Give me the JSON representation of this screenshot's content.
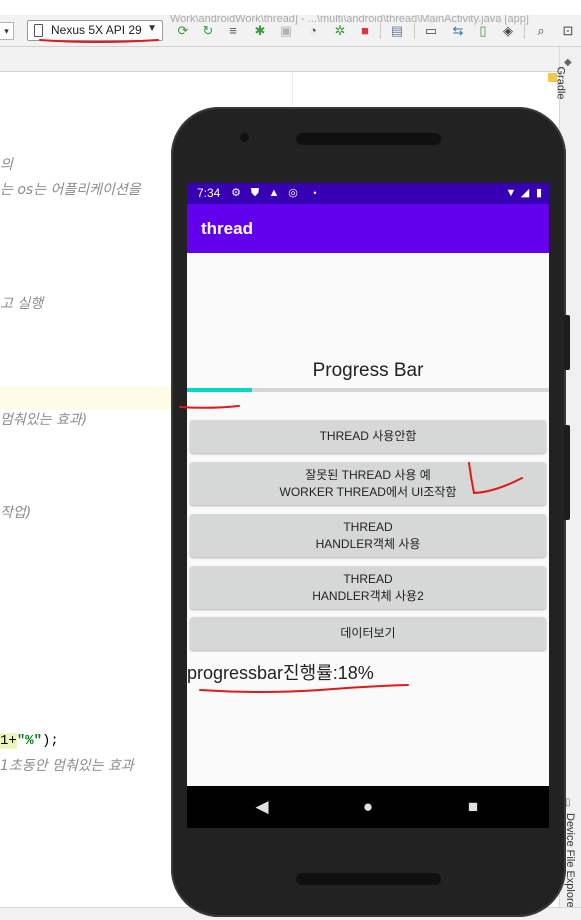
{
  "ide": {
    "title": "Work\\androidWork\\thread] - ...\\multi\\android\\thread\\MainActivity.java [app]",
    "device_select": "Nexus 5X API 29",
    "sidebar_tab_top": "Gradle",
    "sidebar_tab_bottom": "Device File Explorer",
    "code_lines": [
      "의",
      "는 os는 어플리케이션을",
      "고 실행",
      "멈춰있는 효과)",
      "작업)",
      "1초동안 멈춰있는 효과"
    ],
    "code_string_part1": "1+",
    "code_string_part2": "\"%\"",
    "code_string_part3": ");"
  },
  "device": {
    "status_time": "7:34",
    "app_title": "thread",
    "progress_label": "Progress Bar",
    "progress": 0.18,
    "buttons": [
      {
        "line1": "THREAD 사용안함",
        "line2": ""
      },
      {
        "line1": "잘못된 THREAD 사용 예",
        "line2": "WORKER THREAD에서 UI조작함"
      },
      {
        "line1": "THREAD",
        "line2": "HANDLER객체 사용"
      },
      {
        "line1": "THREAD",
        "line2": "HANDLER객체 사용2"
      },
      {
        "line1": "데이터보기",
        "line2": ""
      }
    ],
    "result_text": "progressbar진행률:18%"
  },
  "colors": {
    "status_bar": "#3700b3",
    "app_bar": "#6200ee",
    "progress_fill": "#03dac5",
    "annotation": "#e0191b"
  }
}
